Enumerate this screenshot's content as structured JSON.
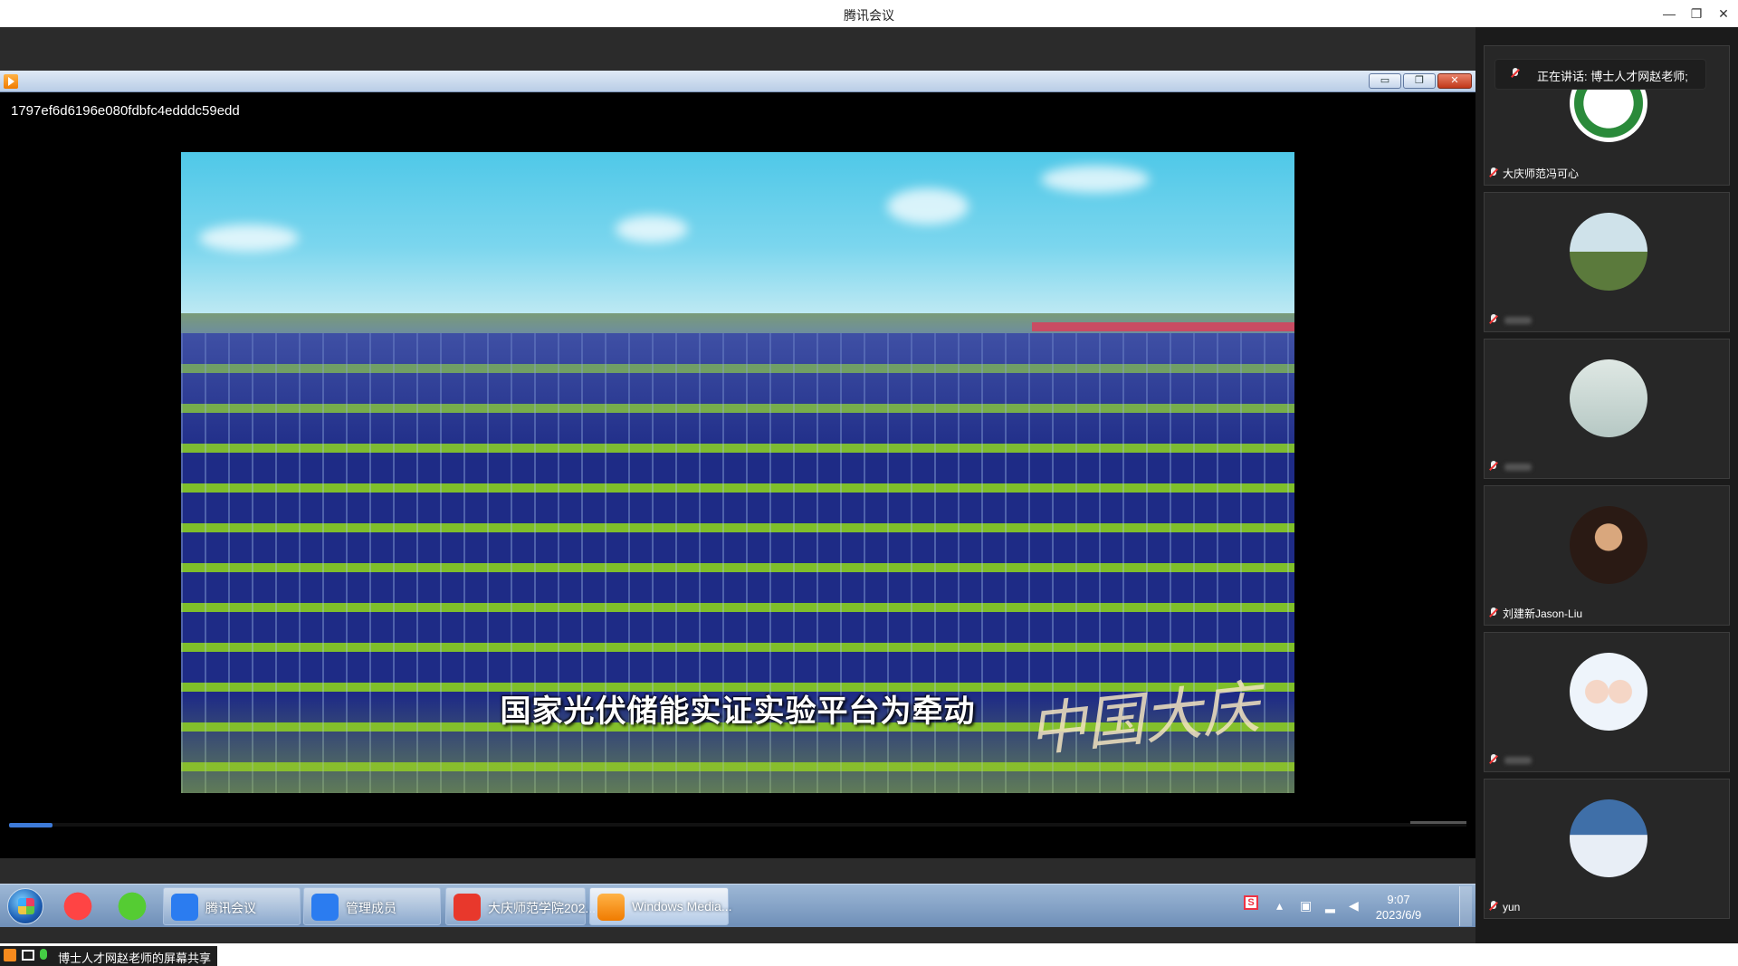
{
  "app": {
    "title": "腾讯会议",
    "window_controls": {
      "minimize": "—",
      "restore": "❐",
      "close": "✕"
    }
  },
  "player": {
    "media_name": "1797ef6d6196e080fdbfc4edddc59edd",
    "subtitle": "国家光伏储能实证实验平台为牵动",
    "watermark": "中国大庆",
    "progress_fraction": 0.03,
    "window_buttons": {
      "minimize": "▭",
      "restore": "❐",
      "close": "✕"
    }
  },
  "taskbar": {
    "items": [
      {
        "label": "腾讯会议",
        "icon": "tencent-meeting-icon"
      },
      {
        "label": "管理成员",
        "icon": "tencent-meeting-icon"
      },
      {
        "label": "大庆师范学院202...",
        "icon": "wps-icon"
      },
      {
        "label": "Windows Media...",
        "icon": "windows-media-player-icon"
      }
    ],
    "tray": {
      "sogou": "S",
      "time": "9:07",
      "date": "2023/6/9"
    }
  },
  "share_status": {
    "text": "博士人才网赵老师的屏幕共享"
  },
  "participants_panel": {
    "speaking_label": "正在讲话:",
    "speaking_name": "博士人才网赵老师;",
    "participants": [
      {
        "name": "大庆师范冯可心",
        "avatar": "school-emblem"
      },
      {
        "name": "",
        "avatar": "palm-tree-photo"
      },
      {
        "name": "",
        "avatar": "couple-photo"
      },
      {
        "name": "刘建新Jason-Liu",
        "avatar": "man-photo"
      },
      {
        "name": "",
        "avatar": "cartoon-couple"
      },
      {
        "name": "yun",
        "avatar": "snow-landscape"
      }
    ]
  }
}
